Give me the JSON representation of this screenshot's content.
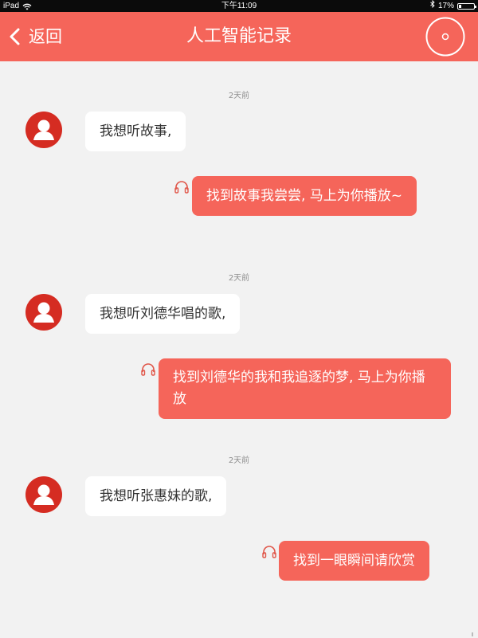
{
  "status_bar": {
    "device": "iPad",
    "time": "下午11:09",
    "battery": "17%",
    "battery_level": 0.17
  },
  "nav": {
    "back_label": "返回",
    "title": "人工智能记录"
  },
  "messages": [
    {
      "timestamp": "2天前",
      "question": "我想听故事,",
      "answer": "找到故事我尝尝, 马上为你播放~"
    },
    {
      "timestamp": "2天前",
      "question": "我想听刘德华唱的歌,",
      "answer": "找到刘德华的我和我追逐的梦, 马上为你播放"
    },
    {
      "timestamp": "2天前",
      "question": "我想听张惠妹的歌,",
      "answer": "找到一眼瞬间请欣赏"
    }
  ],
  "colors": {
    "accent": "#f5655a",
    "background": "#f2f2f2",
    "avatar": "#d52c22"
  }
}
